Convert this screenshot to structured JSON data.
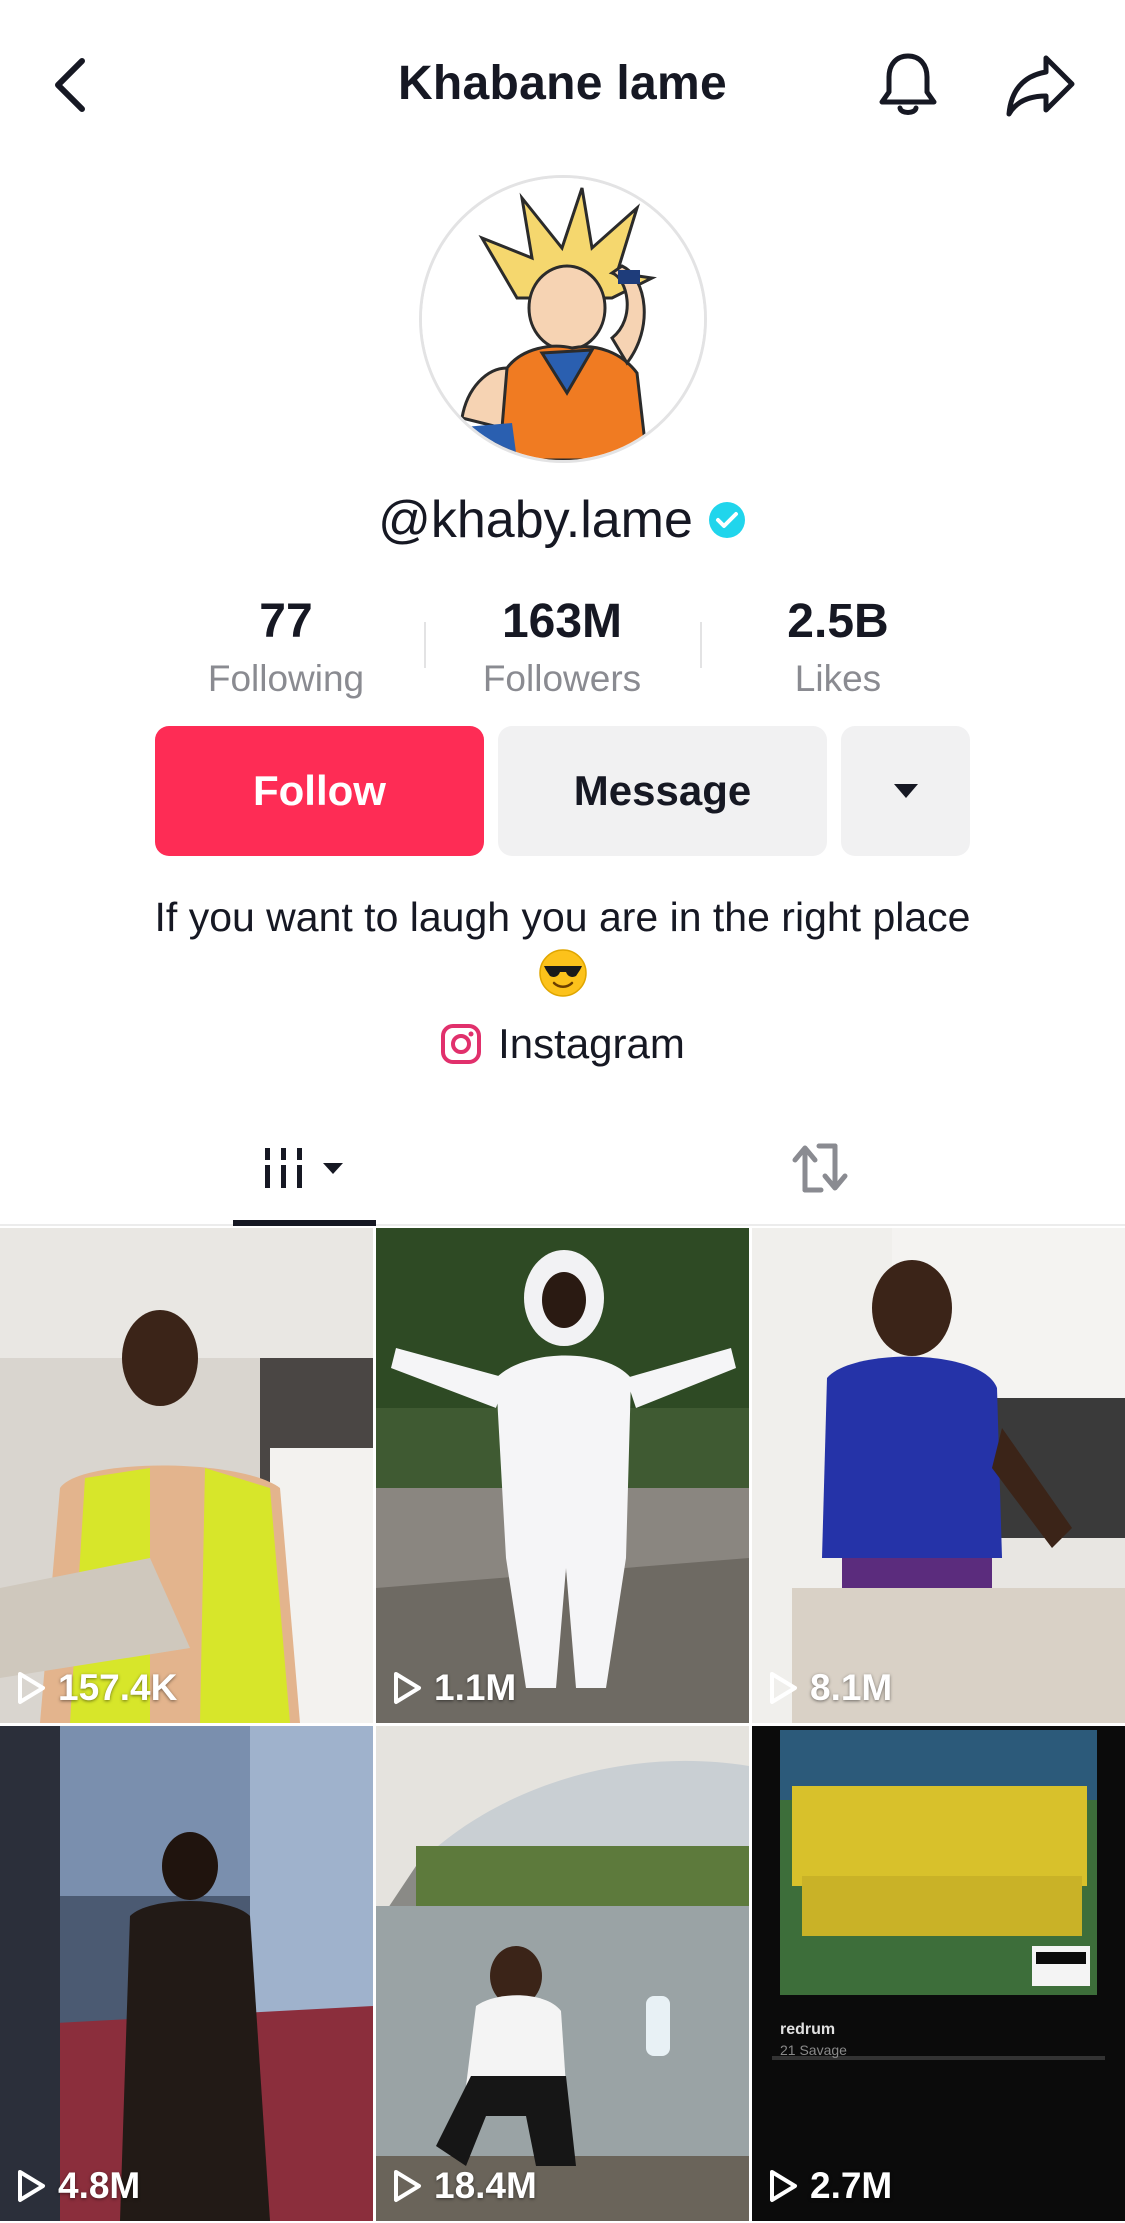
{
  "header": {
    "title": "Khabane lame",
    "back_icon": "chevron-left-icon",
    "notify_icon": "bell-icon",
    "share_icon": "share-arrow-icon"
  },
  "profile": {
    "handle": "@khaby.lame",
    "verified": true,
    "verified_color": "#20d5ec",
    "stats": [
      {
        "value": "77",
        "label": "Following"
      },
      {
        "value": "163M",
        "label": "Followers"
      },
      {
        "value": "2.5B",
        "label": "Likes"
      }
    ],
    "bio": "If you want to laugh you are in the right place",
    "bio_emoji": "😎",
    "link_label": "Instagram"
  },
  "actions": {
    "follow_label": "Follow",
    "message_label": "Message",
    "follow_color": "#fe2c55"
  },
  "tabs": {
    "videos_icon": "grid-videos-icon",
    "reposts_icon": "repost-icon"
  },
  "videos": [
    {
      "views": "157.4K"
    },
    {
      "views": "1.1M"
    },
    {
      "views": "8.1M"
    },
    {
      "views": "4.8M"
    },
    {
      "views": "18.4M"
    },
    {
      "views": "2.7M"
    }
  ],
  "video_overlay": {
    "track": "redrum",
    "artist": "21 Savage",
    "advisory": "PARENTAL ADVISORY EXPLICIT CONTENT"
  }
}
